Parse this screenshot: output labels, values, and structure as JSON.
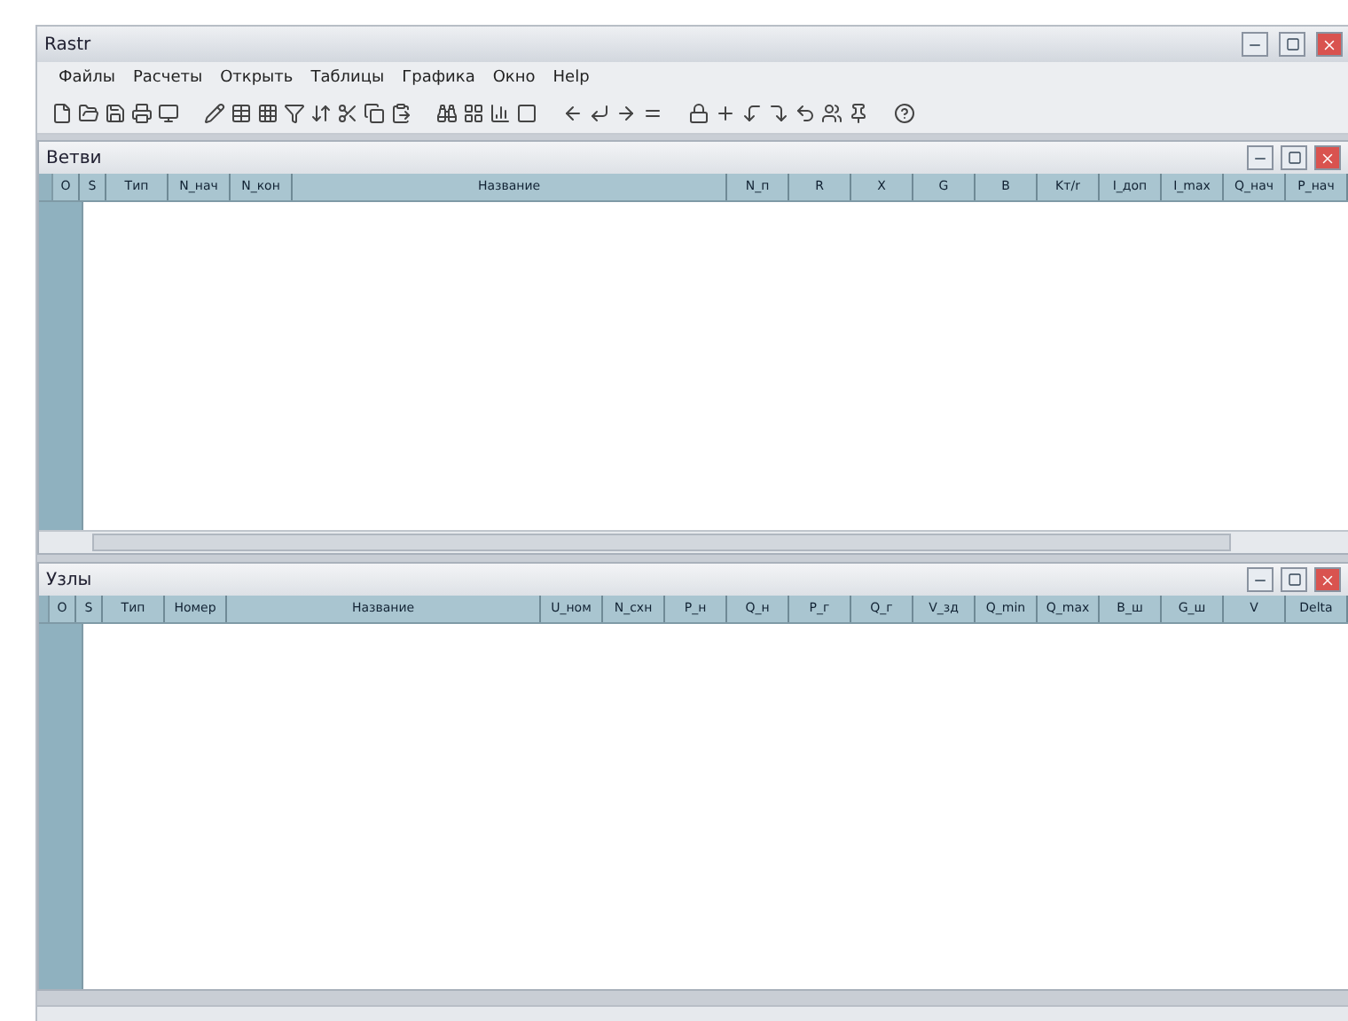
{
  "window": {
    "title": "Rastr"
  },
  "menu": [
    "Файлы",
    "Расчеты",
    "Открыть",
    "Таблицы",
    "Графика",
    "Окно",
    "Help"
  ],
  "child_windows": [
    {
      "title": "Ветви",
      "columns": [
        "О",
        "S",
        "Тип",
        "N_нач",
        "N_кон",
        "Название",
        "N_п",
        "R",
        "X",
        "G",
        "B",
        "Kт/r",
        "I_доп",
        "I_max",
        "Q_нач",
        "P_нач"
      ],
      "scrollbar": true
    },
    {
      "title": "Узлы",
      "columns": [
        "О",
        "S",
        "Тип",
        "Номер",
        "Название",
        "U_ном",
        "N_схн",
        "P_н",
        "Q_н",
        "P_г",
        "Q_г",
        "V_зд",
        "Q_min",
        "Q_max",
        "B_ш",
        "G_ш",
        "V",
        "Delta"
      ],
      "scrollbar": false
    }
  ]
}
